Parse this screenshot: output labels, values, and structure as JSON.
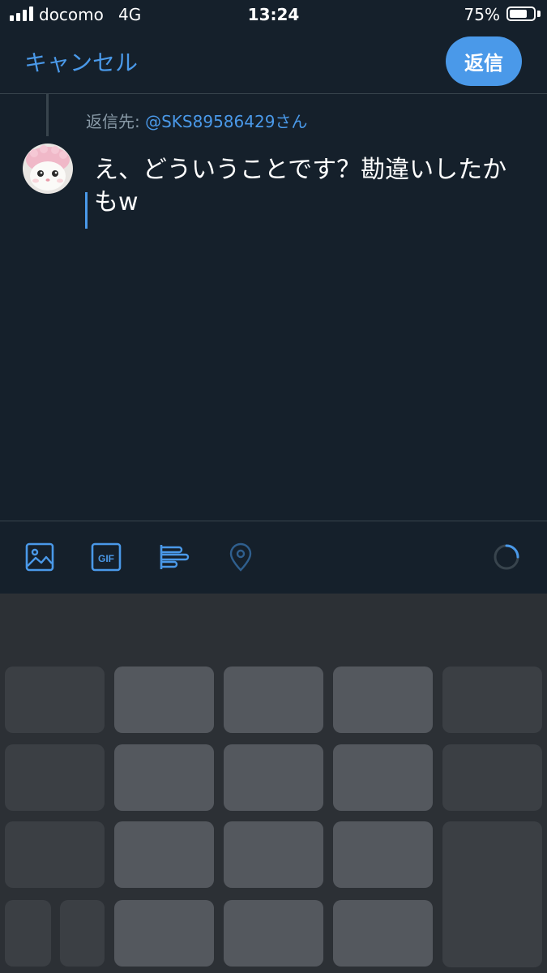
{
  "status_bar": {
    "carrier": "docomo",
    "network": "4G",
    "time": "13:24",
    "battery_percent": "75%",
    "battery_level": 0.75
  },
  "header": {
    "cancel_label": "キャンセル",
    "reply_label": "返信"
  },
  "compose": {
    "reply_to_prefix": "返信先: ",
    "reply_to_handle": "@SKS89586429さん",
    "text": "え、どういうことです？勘違いしたかもw"
  },
  "toolbar": {
    "icons": [
      "image-icon",
      "gif-icon",
      "poll-icon",
      "location-icon",
      "character-count-ring-icon"
    ],
    "gif_label": "GIF"
  },
  "colors": {
    "background": "#15202b",
    "accent": "#4a99e9",
    "divider": "#38444d",
    "muted_text": "#8899a6",
    "keyboard_bg": "#2c3035",
    "key": "#54585e",
    "key_dark": "#3b3f44"
  }
}
